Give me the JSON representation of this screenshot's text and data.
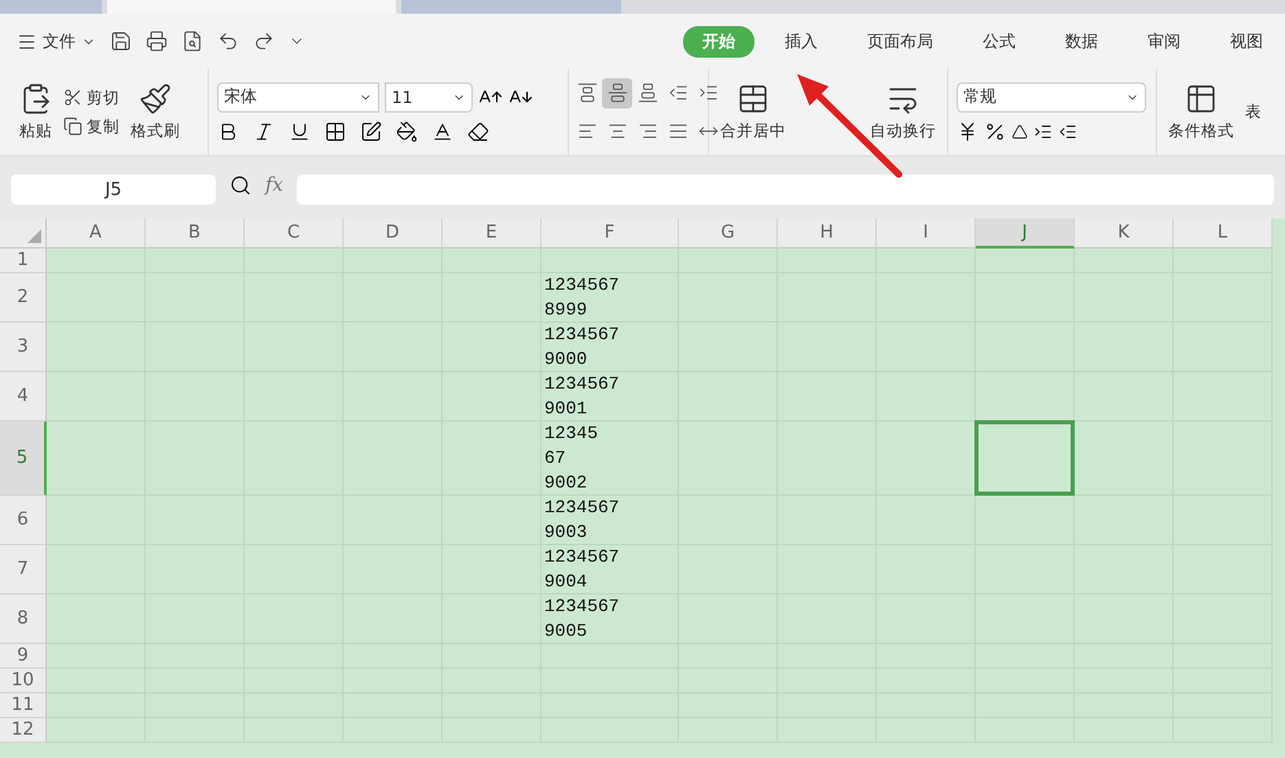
{
  "title_tabs": [
    {
      "selected": false
    },
    {
      "selected": true
    },
    {
      "selected": false
    }
  ],
  "menu_label": "文件",
  "ribbon_tabs": [
    {
      "label": "开始",
      "selected": true
    },
    {
      "label": "插入",
      "selected": false
    },
    {
      "label": "页面布局",
      "selected": false
    },
    {
      "label": "公式",
      "selected": false
    },
    {
      "label": "数据",
      "selected": false
    },
    {
      "label": "审阅",
      "selected": false
    },
    {
      "label": "视图",
      "selected": false
    }
  ],
  "clipboard": {
    "paste": "粘贴",
    "cut": "剪切",
    "copy": "复制",
    "format_painter": "格式刷"
  },
  "font": {
    "name": "宋体",
    "size": "11"
  },
  "align_buttons": [
    {
      "kind": "top",
      "selected": false
    },
    {
      "kind": "middle",
      "selected": true
    },
    {
      "kind": "bottom",
      "selected": false
    },
    {
      "kind": "outdent",
      "selected": false
    },
    {
      "kind": "indent",
      "selected": false
    },
    {
      "kind": "left",
      "selected": false
    },
    {
      "kind": "center",
      "selected": false
    },
    {
      "kind": "right",
      "selected": false
    },
    {
      "kind": "justify",
      "selected": false
    },
    {
      "kind": "distribute",
      "selected": false
    }
  ],
  "merge_label": "合并居中",
  "wrap_label": "自动换行",
  "number_format": "常规",
  "conditional_label": "条件格式",
  "cut_label": "表",
  "formula_bar": {
    "cell_ref": "J5",
    "fx": "fx"
  },
  "columns": [
    {
      "label": "A",
      "selected": false
    },
    {
      "label": "B",
      "selected": false
    },
    {
      "label": "C",
      "selected": false
    },
    {
      "label": "D",
      "selected": false
    },
    {
      "label": "E",
      "selected": false
    },
    {
      "label": "F",
      "selected": false
    },
    {
      "label": "G",
      "selected": false
    },
    {
      "label": "H",
      "selected": false
    },
    {
      "label": "I",
      "selected": false
    },
    {
      "label": "J",
      "selected": true
    },
    {
      "label": "K",
      "selected": false
    },
    {
      "label": "L",
      "selected": false
    }
  ],
  "rows": [
    {
      "label": "1",
      "selected": false
    },
    {
      "label": "2",
      "selected": false,
      "column_f": [
        "1234567",
        "8999"
      ]
    },
    {
      "label": "3",
      "selected": false,
      "column_f": [
        "1234567",
        "9000"
      ]
    },
    {
      "label": "4",
      "selected": false,
      "column_f": [
        "1234567",
        "9001"
      ]
    },
    {
      "label": "5",
      "selected": true,
      "column_f": [
        "12345",
        "67",
        "9002"
      ]
    },
    {
      "label": "6",
      "selected": false,
      "column_f": [
        "1234567",
        "9003"
      ]
    },
    {
      "label": "7",
      "selected": false,
      "column_f": [
        "1234567",
        "9004"
      ]
    },
    {
      "label": "8",
      "selected": false,
      "column_f": [
        "1234567",
        "9005"
      ]
    },
    {
      "label": "9",
      "selected": false
    },
    {
      "label": "10",
      "selected": false
    },
    {
      "label": "11",
      "selected": false
    },
    {
      "label": "12",
      "selected": false
    }
  ]
}
